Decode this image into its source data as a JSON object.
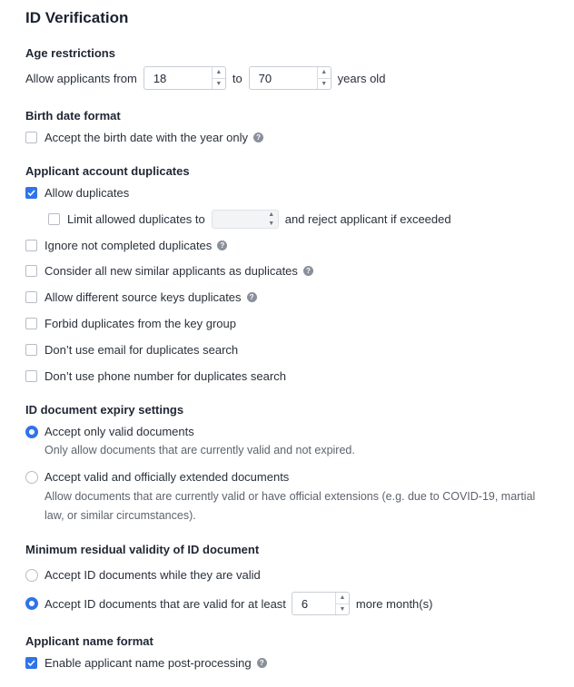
{
  "title": "ID Verification",
  "age": {
    "section": "Age restrictions",
    "prefix": "Allow applicants from",
    "from": "18",
    "to_label": "to",
    "to": "70",
    "suffix": "years old"
  },
  "birth": {
    "section": "Birth date format",
    "year_only": "Accept the birth date with the year only"
  },
  "dup": {
    "section": "Applicant account duplicates",
    "allow": "Allow duplicates",
    "limit": "Limit allowed duplicates to",
    "limit_value": "",
    "limit_suffix": "and reject applicant if exceeded",
    "ignore": "Ignore not completed duplicates",
    "consider": "Consider all new similar applicants as duplicates",
    "source_keys": "Allow different source keys duplicates",
    "forbid": "Forbid duplicates from the key group",
    "no_email": "Don’t use email for duplicates search",
    "no_phone": "Don’t use phone number for duplicates search"
  },
  "expiry": {
    "section": "ID document expiry settings",
    "valid_only": "Accept only valid documents",
    "valid_only_desc": "Only allow documents that are currently valid and not expired.",
    "extended": "Accept valid and officially extended documents",
    "extended_desc_1": "Allow documents that are currently valid or have official extensions (e.g. due to COVID-19, martial",
    "extended_desc_2": "law, or similar circumstances)."
  },
  "residual": {
    "section": "Minimum residual validity of ID document",
    "while_valid": "Accept ID documents while they are valid",
    "at_least": "Accept ID documents that are valid for at least",
    "months": "6",
    "months_suffix": "more month(s)"
  },
  "name": {
    "section": "Applicant name format",
    "post_processing": "Enable applicant name post-processing"
  },
  "icons": {
    "help": "?",
    "spin_up": "^",
    "spin_down": "v"
  },
  "colors": {
    "accent": "#2f74e8",
    "help": "#8a909b"
  }
}
